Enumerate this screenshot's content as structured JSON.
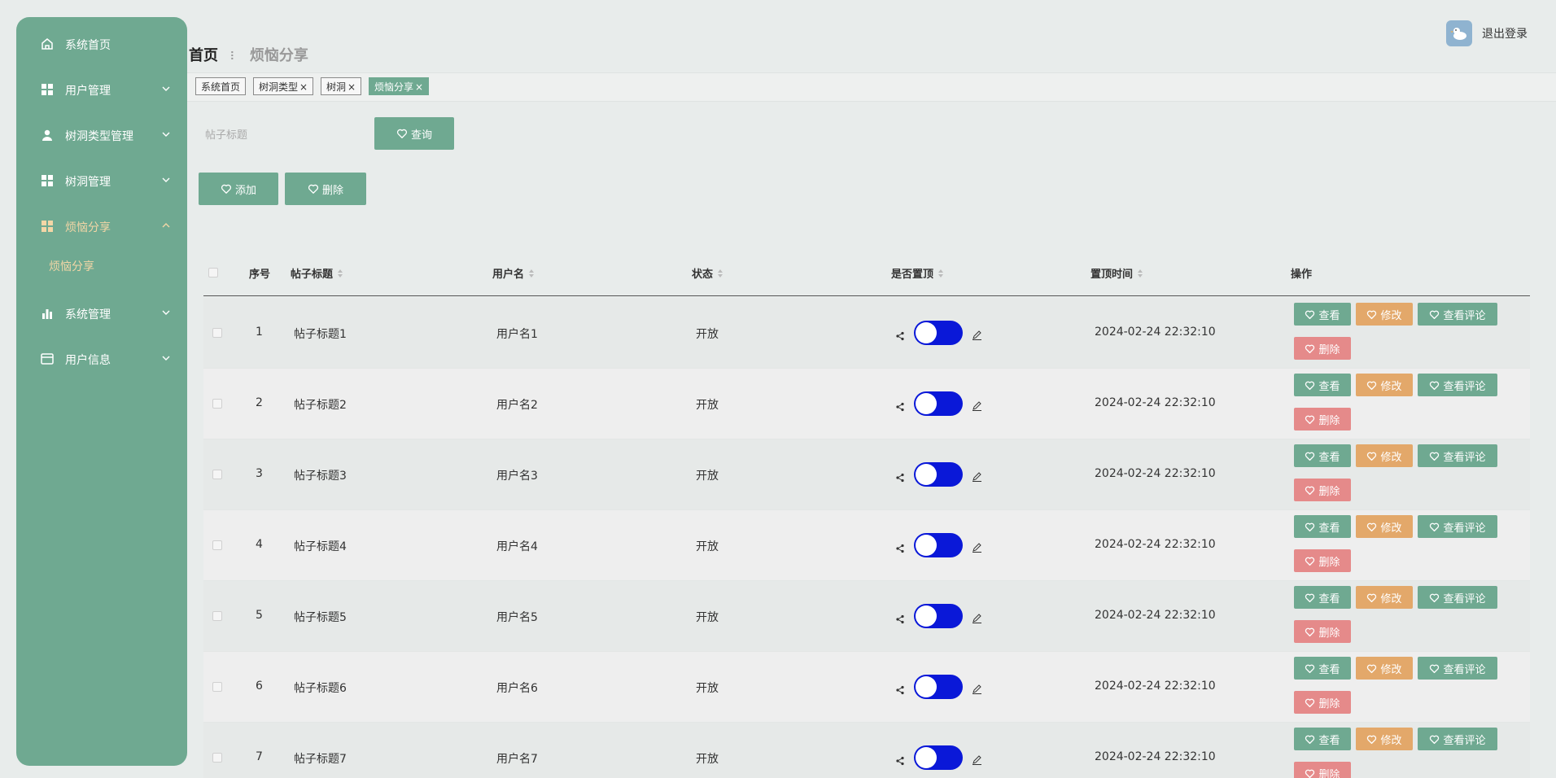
{
  "sidebar": {
    "items": [
      {
        "label": "系统首页",
        "icon": "home-icon",
        "arrow": false,
        "active": false
      },
      {
        "label": "用户管理",
        "icon": "grid-icon",
        "arrow": "down",
        "active": false
      },
      {
        "label": "树洞类型管理",
        "icon": "user-icon",
        "arrow": "down",
        "active": false
      },
      {
        "label": "树洞管理",
        "icon": "grid-icon",
        "arrow": "down",
        "active": false
      },
      {
        "label": "烦恼分享",
        "icon": "grid-icon",
        "arrow": "up",
        "active": true
      },
      {
        "label": "系统管理",
        "icon": "bar-chart-icon",
        "arrow": "down",
        "active": false
      },
      {
        "label": "用户信息",
        "icon": "card-icon",
        "arrow": "down",
        "active": false
      }
    ],
    "sub_item": "烦恼分享"
  },
  "header": {
    "breadcrumb_home": "首页",
    "breadcrumb_current": "烦恼分享",
    "logout": "退出登录"
  },
  "tabs": [
    {
      "label": "系统首页",
      "closable": false,
      "active": false
    },
    {
      "label": "树洞类型",
      "closable": true,
      "active": false
    },
    {
      "label": "树洞",
      "closable": true,
      "active": false
    },
    {
      "label": "烦恼分享",
      "closable": true,
      "active": true
    }
  ],
  "search": {
    "placeholder": "帖子标题",
    "button": "查询"
  },
  "actions": {
    "add": "添加",
    "delete": "删除"
  },
  "table": {
    "columns": [
      "序号",
      "帖子标题",
      "用户名",
      "状态",
      "是否置顶",
      "置顶时间",
      "操作"
    ],
    "row_buttons": {
      "view": "查看",
      "edit": "修改",
      "comments": "查看评论",
      "delete": "删除"
    },
    "rows": [
      {
        "index": "1",
        "title": "帖子标题1",
        "user": "用户名1",
        "status": "开放",
        "top_time": "2024-02-24 22:32:10"
      },
      {
        "index": "2",
        "title": "帖子标题2",
        "user": "用户名2",
        "status": "开放",
        "top_time": "2024-02-24 22:32:10"
      },
      {
        "index": "3",
        "title": "帖子标题3",
        "user": "用户名3",
        "status": "开放",
        "top_time": "2024-02-24 22:32:10"
      },
      {
        "index": "4",
        "title": "帖子标题4",
        "user": "用户名4",
        "status": "开放",
        "top_time": "2024-02-24 22:32:10"
      },
      {
        "index": "5",
        "title": "帖子标题5",
        "user": "用户名5",
        "status": "开放",
        "top_time": "2024-02-24 22:32:10"
      },
      {
        "index": "6",
        "title": "帖子标题6",
        "user": "用户名6",
        "status": "开放",
        "top_time": "2024-02-24 22:32:10"
      },
      {
        "index": "7",
        "title": "帖子标题7",
        "user": "用户名7",
        "status": "开放",
        "top_time": "2024-02-24 22:32:10"
      }
    ]
  },
  "colors": {
    "primary": "#6fa991",
    "warning": "#e3a86a",
    "danger": "#e58a8a",
    "switch_on": "#0a18d8",
    "active_menu": "#f3d6a6"
  }
}
